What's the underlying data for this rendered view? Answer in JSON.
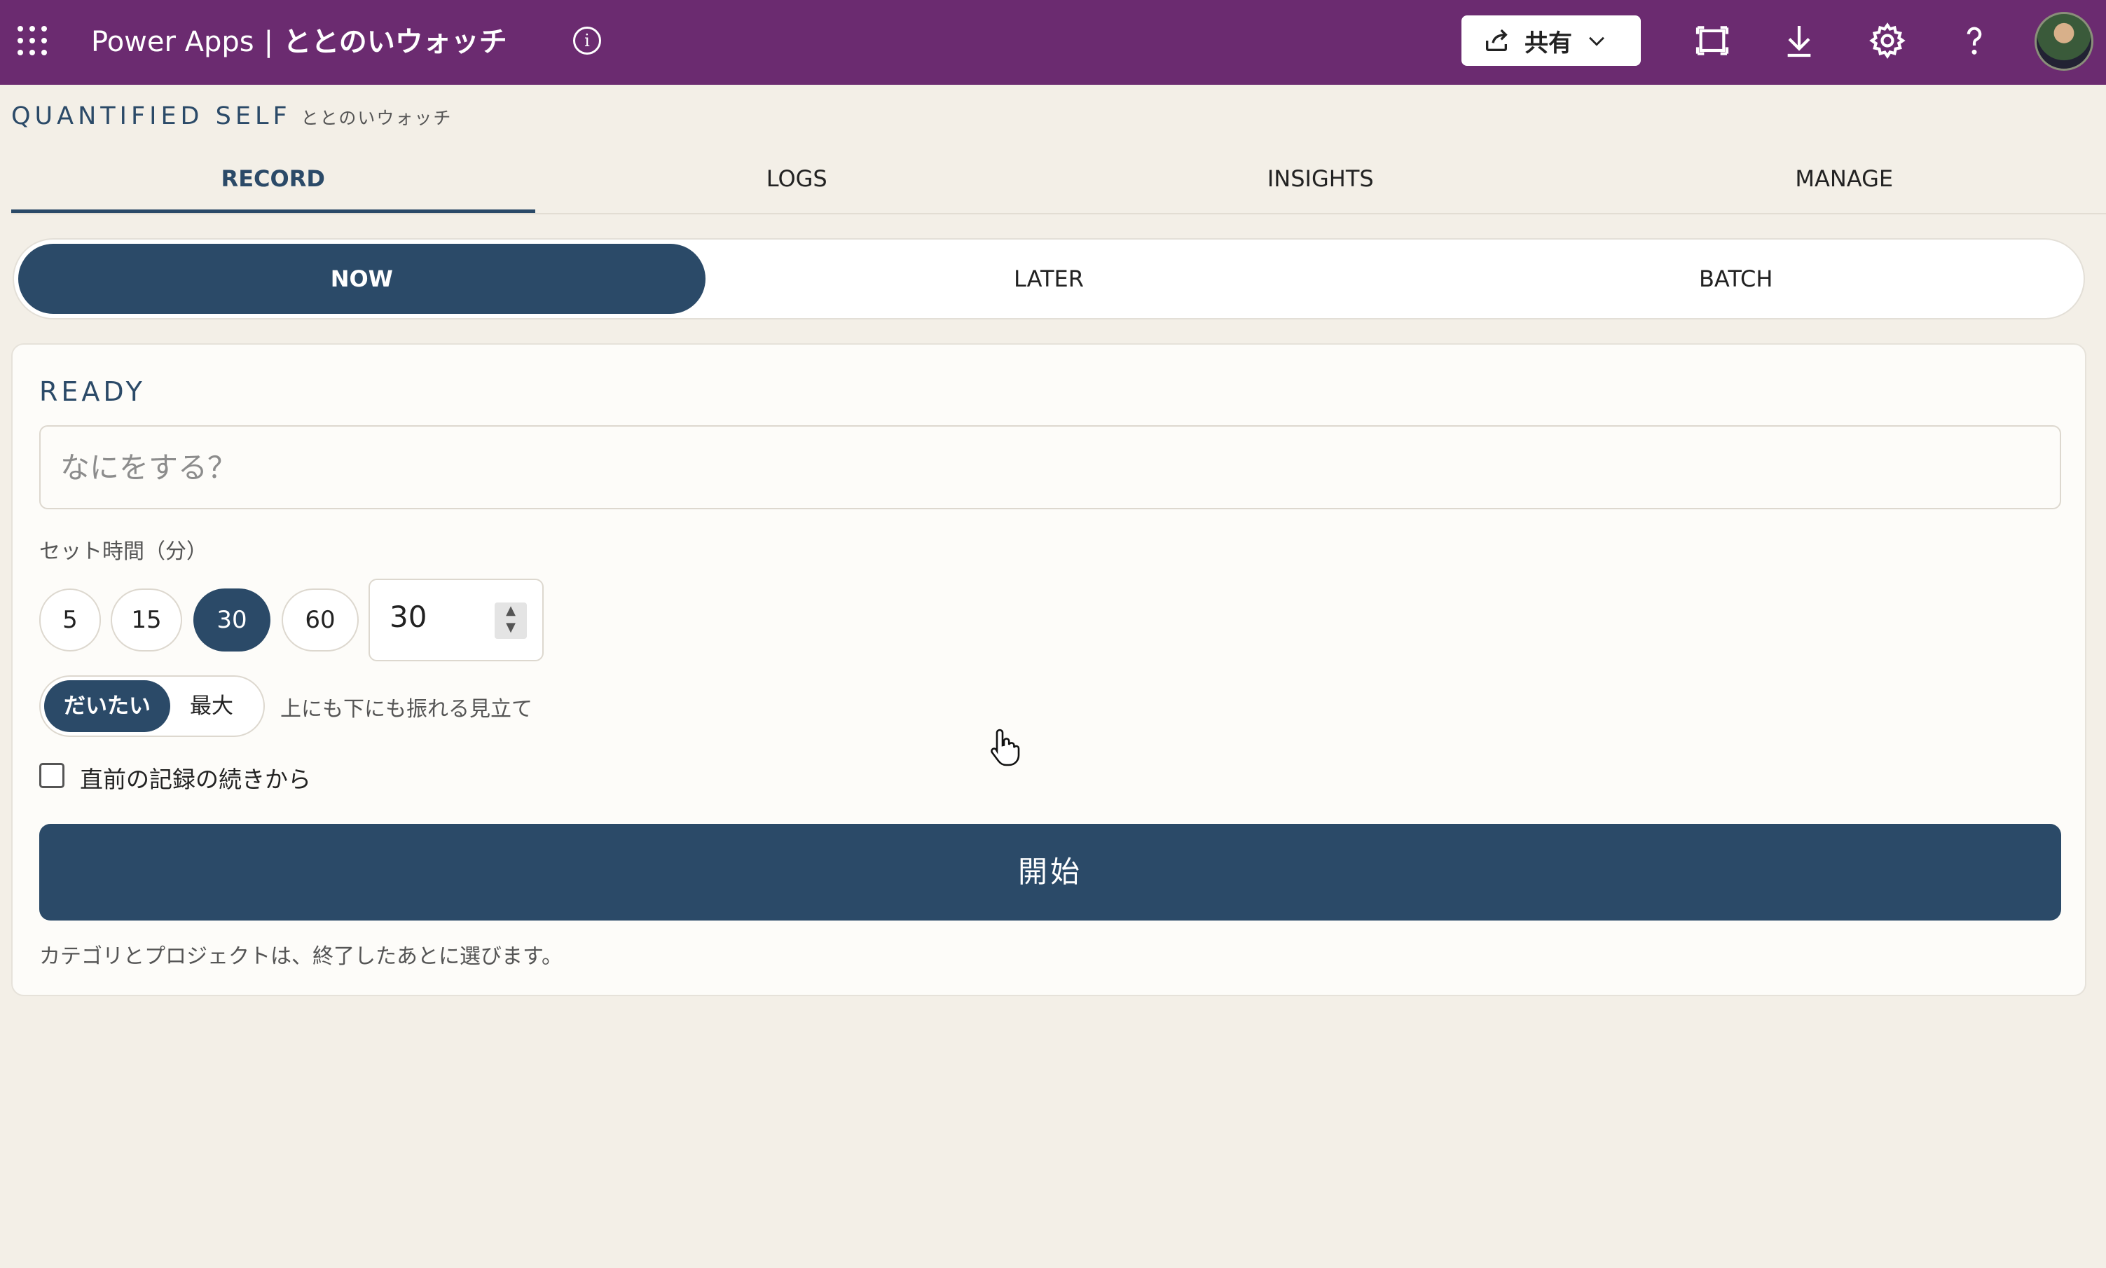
{
  "topbar": {
    "product": "Power Apps",
    "separator": "|",
    "app_name": "ととのいウォッチ",
    "share_label": "共有",
    "colors": {
      "bar": "#6b2b70"
    }
  },
  "header": {
    "brand": "QUANTIFIED SELF",
    "brand_sub": "ととのいウォッチ"
  },
  "tabs": [
    {
      "label": "RECORD",
      "active": true
    },
    {
      "label": "LOGS"
    },
    {
      "label": "INSIGHTS"
    },
    {
      "label": "MANAGE"
    }
  ],
  "segments": [
    {
      "label": "NOW",
      "active": true
    },
    {
      "label": "LATER"
    },
    {
      "label": "BATCH"
    }
  ],
  "card": {
    "status": "READY",
    "task_placeholder": "なにをする？",
    "task_value": "",
    "set_time_label": "セット時間（分）",
    "presets": [
      "5",
      "15",
      "30",
      "60"
    ],
    "selected_preset": "30",
    "minutes_value": "30",
    "mode_options": [
      "だいたい",
      "最大"
    ],
    "mode_selected": "だいたい",
    "mode_hint": "上にも下にも振れる見立て",
    "continue_label": "直前の記録の続きから",
    "continue_checked": false,
    "start_label": "開始",
    "note": "カテゴリとプロジェクトは、終了したあとに選びます。"
  },
  "colors": {
    "accent": "#2b4a68",
    "background": "#f3efe7"
  }
}
